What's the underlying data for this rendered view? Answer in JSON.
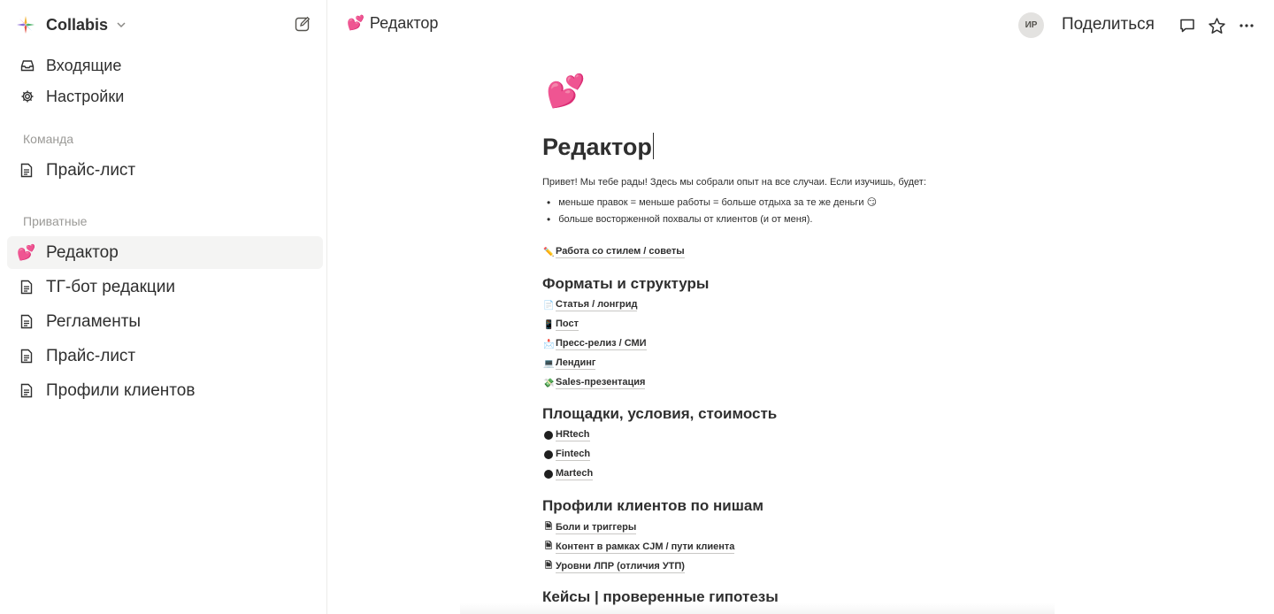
{
  "workspace": {
    "name": "Collabis"
  },
  "nav": {
    "inbox": "Входящие",
    "settings": "Настройки"
  },
  "sections": {
    "team": {
      "title": "Команда",
      "items": [
        {
          "label": "Прайс-лист"
        }
      ]
    },
    "private": {
      "title": "Приватные",
      "items": [
        {
          "label": "Редактор",
          "emoji": "💕",
          "active": true
        },
        {
          "label": "ТГ-бот редакции"
        },
        {
          "label": "Регламенты"
        },
        {
          "label": "Прайс-лист"
        },
        {
          "label": "Профили клиентов"
        }
      ]
    }
  },
  "topbar": {
    "page_emoji": "💕",
    "page_title": "Редактор",
    "avatar_initials": "ИР",
    "share_label": "Поделиться"
  },
  "doc": {
    "emoji": "💕",
    "title": "Редактор",
    "intro": "Привет! Мы тебе рады! Здесь мы собрали опыт на все случаи. Если изучишь, будет:",
    "bullets": [
      "меньше правок = меньше работы = больше отдыха  за те же деньги 😏",
      "больше восторженной похвалы от клиентов (и от меня)."
    ],
    "style_link": {
      "emoji": "✏️",
      "label": "Работа со стилем / советы"
    },
    "formats": {
      "heading": "Форматы и структуры",
      "links": [
        {
          "emoji": "📄",
          "label": "Статья / лонгрид"
        },
        {
          "emoji": "📱",
          "label": "Пост"
        },
        {
          "emoji": "📩",
          "label": "Пресс-релиз / СМИ"
        },
        {
          "emoji": "💻",
          "label": "Лендинг"
        },
        {
          "emoji": "💸",
          "label": "Sales-презентация"
        }
      ]
    },
    "platforms": {
      "heading": "Площадки, условия, стоимость",
      "links": [
        {
          "label": "HRtech"
        },
        {
          "label": "Fintech"
        },
        {
          "label": "Martech"
        }
      ]
    },
    "profiles": {
      "heading": "Профили клиентов по нишам",
      "links": [
        {
          "emoji": "🗎",
          "label": "Боли и триггеры"
        },
        {
          "emoji": "🗎",
          "label": "Контент в рамках CJM / пути клиента"
        },
        {
          "emoji": "🗎",
          "label": "Уровни ЛПР (отличия УТП)"
        }
      ]
    },
    "cases": {
      "heading": "Кейсы | проверенные гипотезы"
    }
  },
  "colors": {
    "text": "#2f2f2f",
    "muted": "#9b9a97",
    "active_bg": "#f4f4f3"
  },
  "icons": {
    "workspace_logo": "sparkle-logo-icon",
    "inbox": "inbox-icon",
    "settings": "gear-icon",
    "page": "document-icon",
    "compose": "compose-icon",
    "comment": "comment-icon",
    "star": "star-icon",
    "more": "more-icon"
  }
}
